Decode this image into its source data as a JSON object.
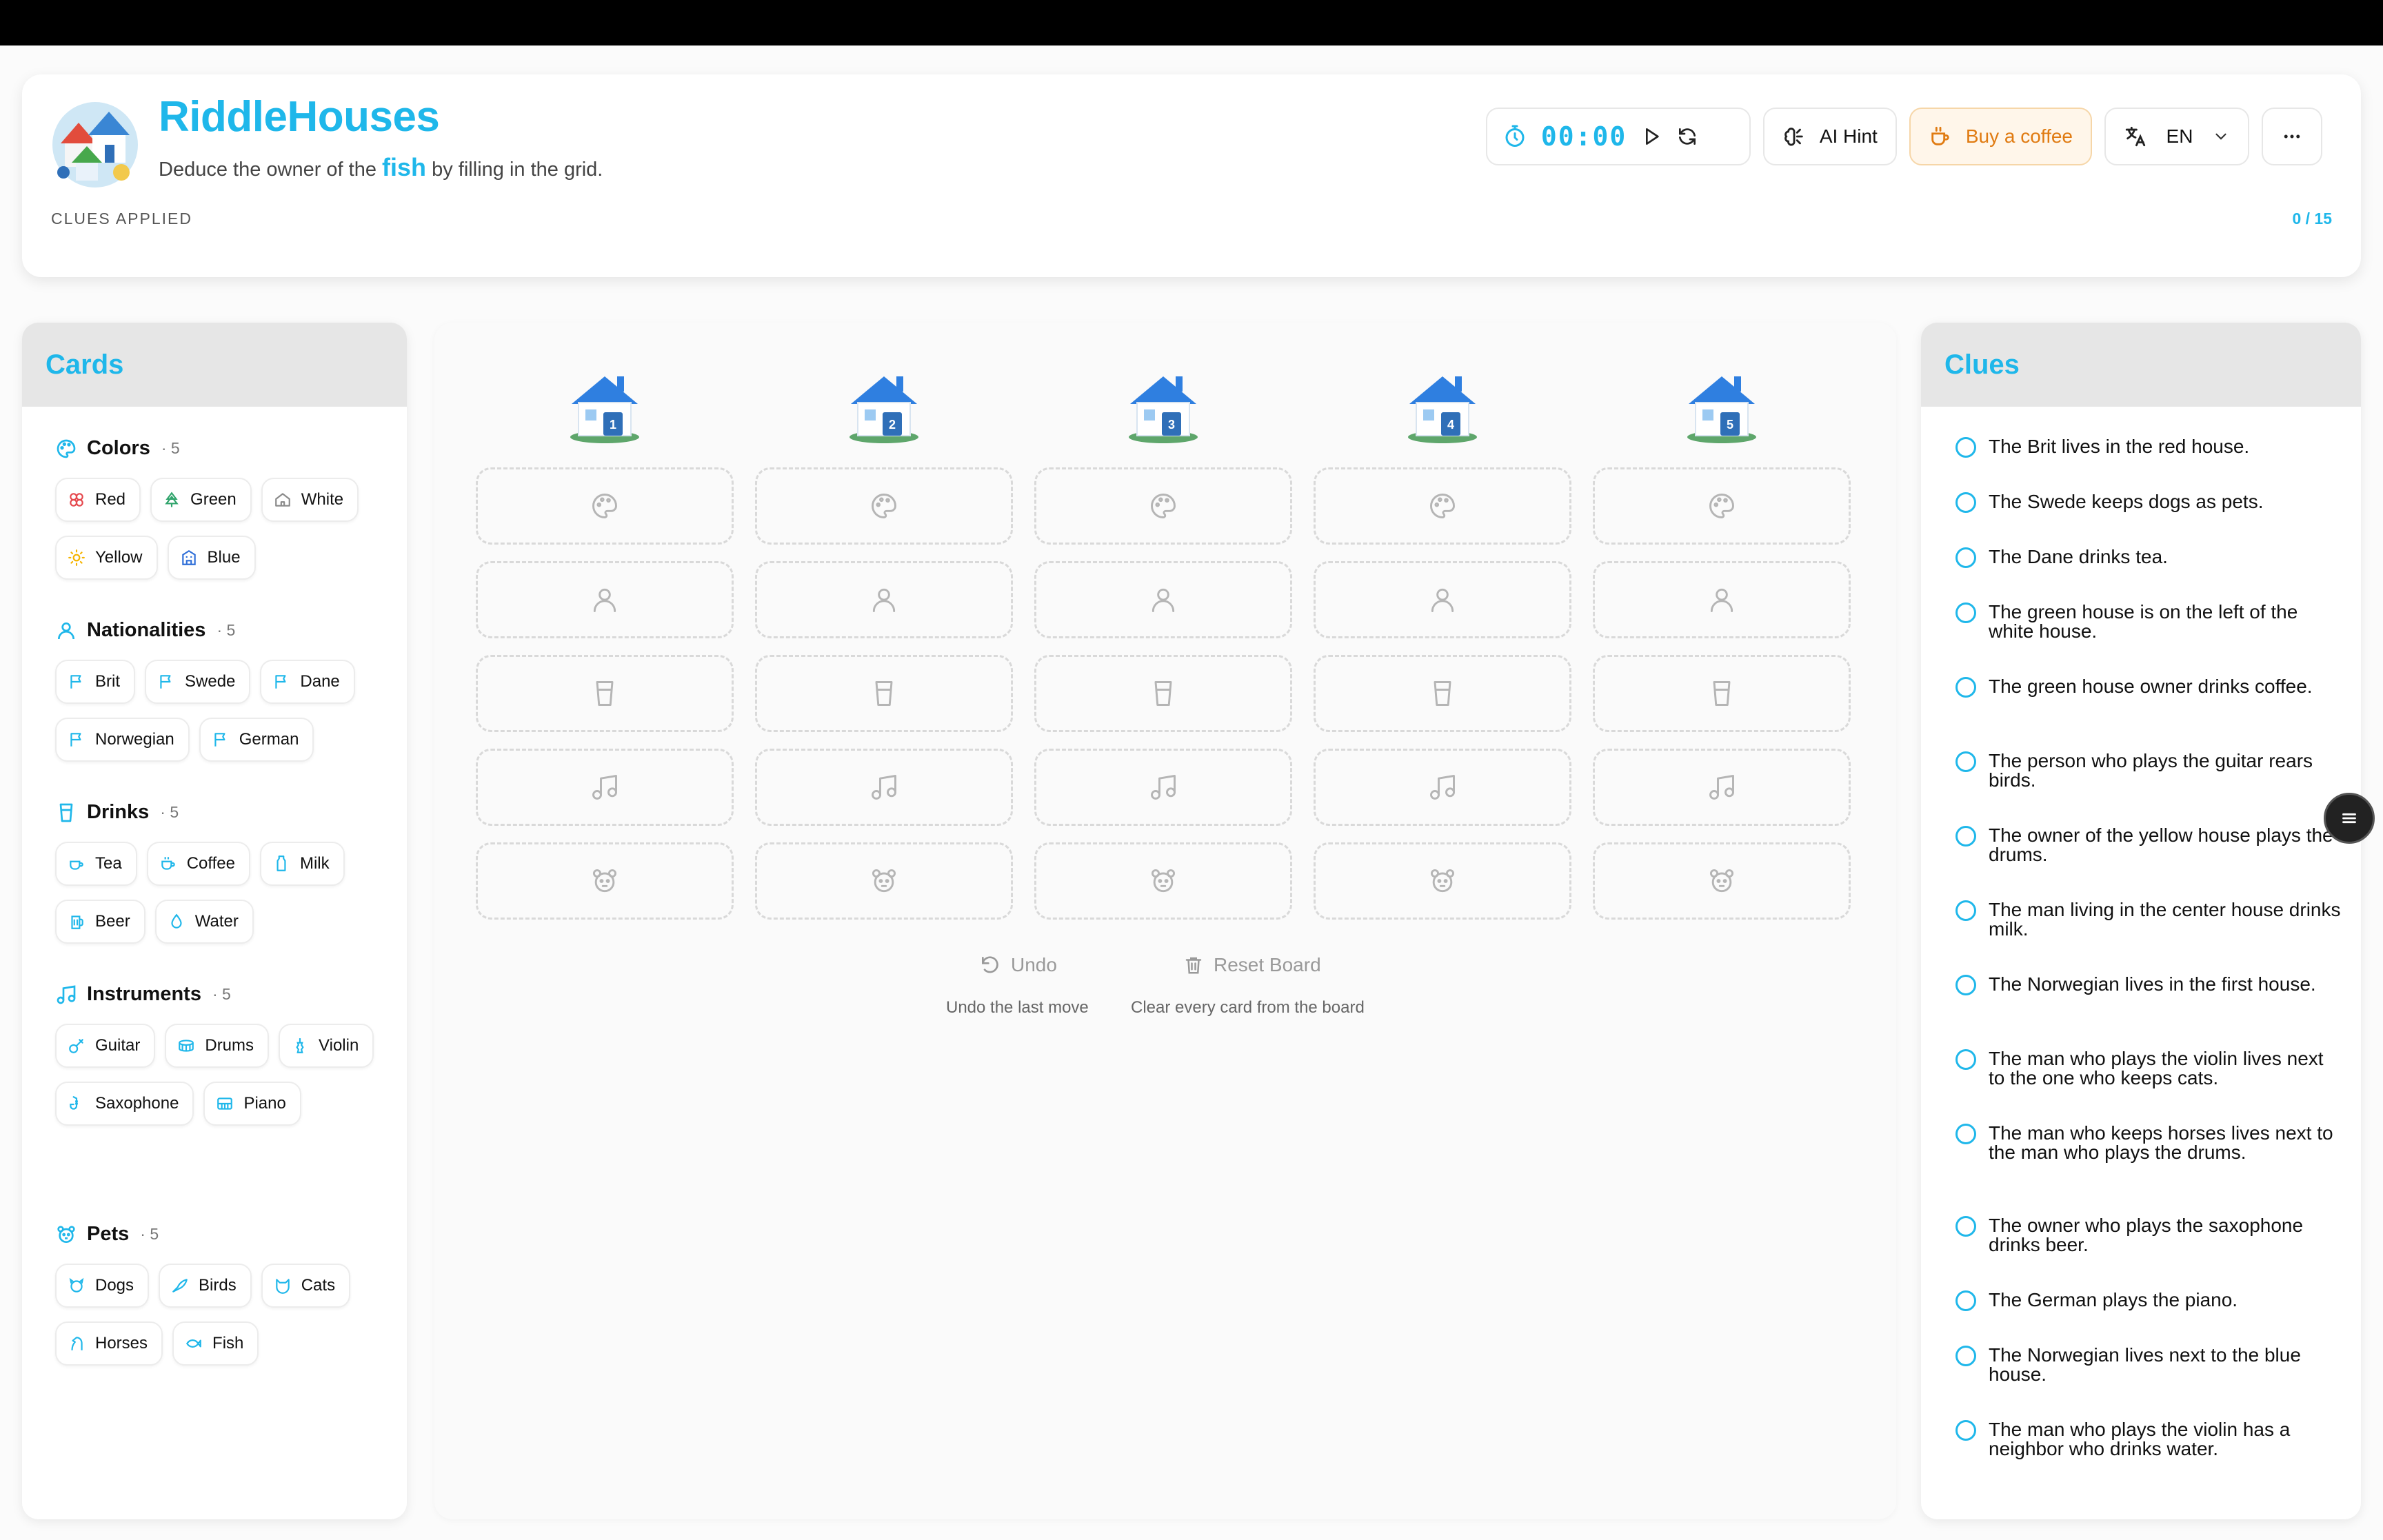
{
  "app": {
    "title": "RiddleHouses",
    "subtitle_before": "Deduce the owner of the",
    "subtitle_highlight": "fish",
    "subtitle_after": "by filling in the grid.",
    "clues_applied_label": "CLUES APPLIED",
    "clues_applied_count": "0 / 15",
    "accent_color": "#1fb7ea"
  },
  "toolbar": {
    "timer": "00:00",
    "ai_hint": "AI Hint",
    "coffee": "Buy a coffee",
    "language": "EN",
    "icons": [
      "stopwatch-icon",
      "play-icon",
      "refresh-icon",
      "brain-icon",
      "cup-icon",
      "translate-icon",
      "chevron-down-icon",
      "more-icon"
    ]
  },
  "cards": {
    "title": "Cards",
    "categories": [
      {
        "name": "Colors",
        "count": "· 5",
        "icon": "palette-icon",
        "items": [
          "Red",
          "Green",
          "White",
          "Yellow",
          "Blue"
        ]
      },
      {
        "name": "Nationalities",
        "count": "· 5",
        "icon": "person-icon",
        "items": [
          "Brit",
          "Swede",
          "Dane",
          "Norwegian",
          "German"
        ]
      },
      {
        "name": "Drinks",
        "count": "· 5",
        "icon": "glass-icon",
        "items": [
          "Tea",
          "Coffee",
          "Milk",
          "Beer",
          "Water"
        ]
      },
      {
        "name": "Instruments",
        "count": "· 5",
        "icon": "music-icon",
        "items": [
          "Guitar",
          "Drums",
          "Violin",
          "Saxophone",
          "Piano"
        ]
      },
      {
        "name": "Pets",
        "count": "· 5",
        "icon": "pet-icon",
        "items": [
          "Dogs",
          "Birds",
          "Cats",
          "Horses",
          "Fish"
        ]
      }
    ]
  },
  "board": {
    "houses": [
      "1",
      "2",
      "3",
      "4",
      "5"
    ],
    "row_icons": [
      "palette-icon",
      "person-icon",
      "glass-icon",
      "music-icon",
      "pet-icon"
    ],
    "undo_label": "Undo",
    "undo_hint": "Undo the last move",
    "reset_label": "Reset Board",
    "reset_hint": "Clear every card from the board"
  },
  "clues": {
    "title": "Clues",
    "items": [
      "The Brit lives in the red house.",
      "The Swede keeps dogs as pets.",
      "The Dane drinks tea.",
      "The green house is on the left of the white house.",
      "The green house owner drinks coffee.",
      "The person who plays the guitar rears birds.",
      "The owner of the yellow house plays the drums.",
      "The man living in the center house drinks milk.",
      "The Norwegian lives in the first house.",
      "The man who plays the violin lives next to the one who keeps cats.",
      "The man who keeps horses lives next to the man who plays the drums.",
      "The owner who plays the saxophone drinks beer.",
      "The German plays the piano.",
      "The Norwegian lives next to the blue house.",
      "The man who plays the violin has a neighbor who drinks water."
    ]
  }
}
